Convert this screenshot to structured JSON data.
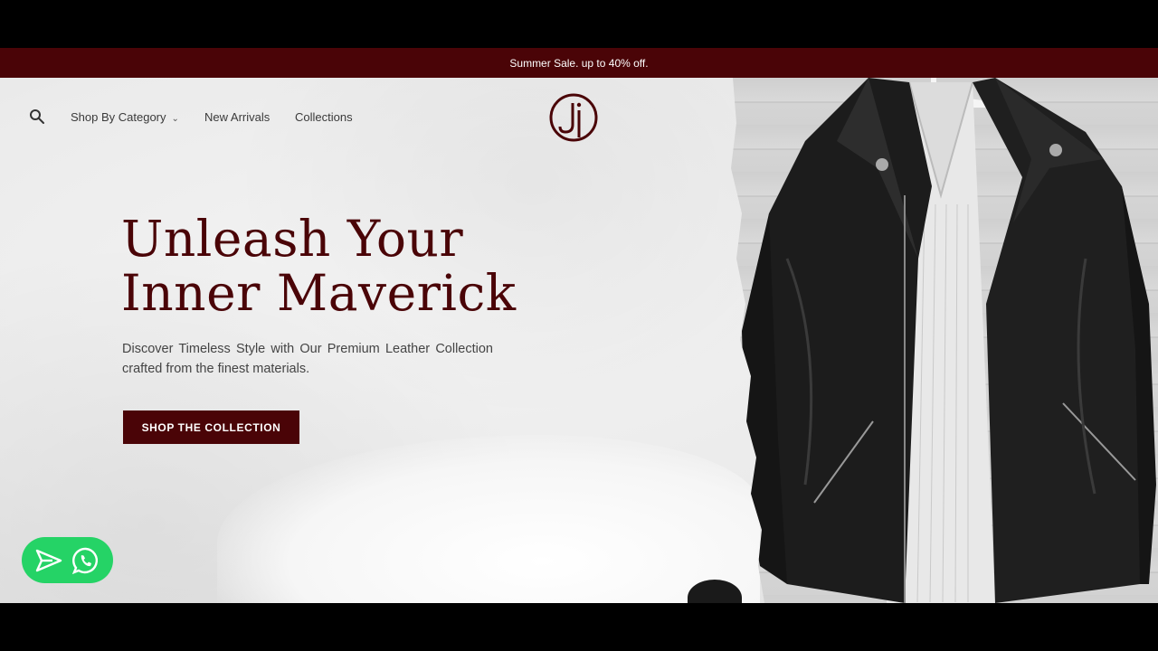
{
  "announcement": {
    "text": "Summer Sale. up to 40% off."
  },
  "nav": {
    "items": [
      {
        "label": "Shop By Category",
        "has_dropdown": true
      },
      {
        "label": "New Arrivals"
      },
      {
        "label": "Collections"
      }
    ]
  },
  "hero": {
    "title_line1": "Unleash Your",
    "title_line2": "Inner Maverick",
    "subtitle": "Discover Timeless Style with Our Premium Leather Collection crafted from the finest materials.",
    "cta_label": "SHOP THE COLLECTION"
  },
  "icons": {
    "search": "search-icon",
    "logo": "brand-logo",
    "chevron": "chevron-down-icon",
    "send": "send-icon",
    "whatsapp": "whatsapp-icon"
  },
  "colors": {
    "brand": "#4a0407",
    "announcement_bg": "#4a0407",
    "chat_widget": "#25d366"
  }
}
